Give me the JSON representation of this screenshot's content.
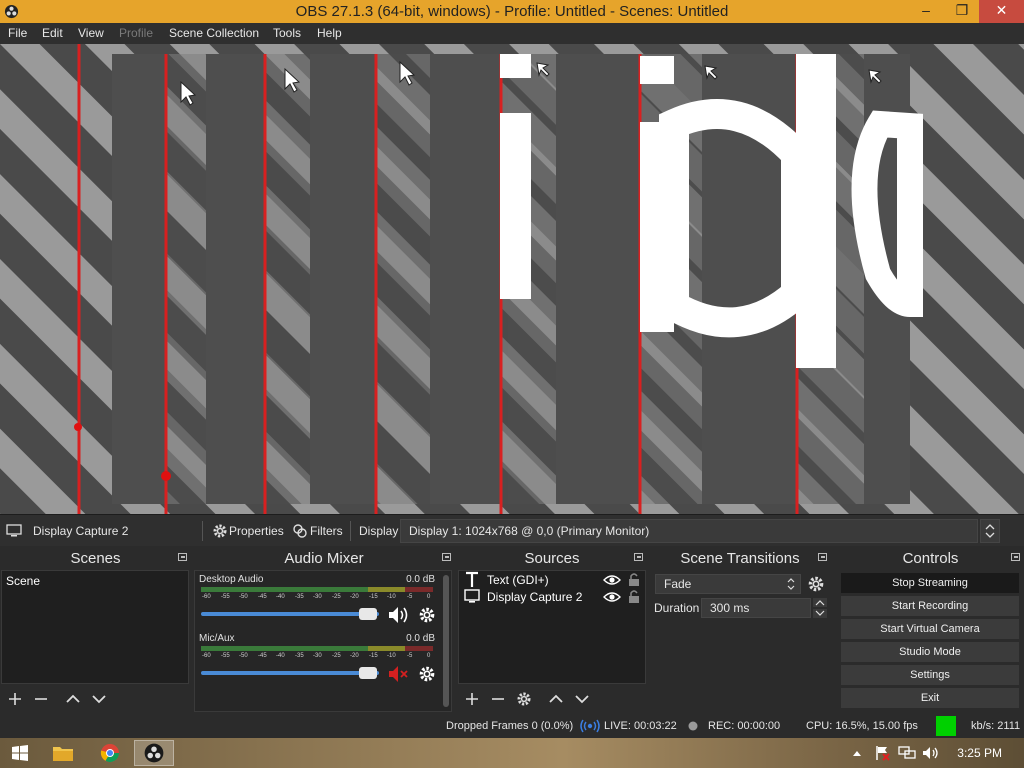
{
  "window": {
    "title": "OBS 27.1.3 (64-bit, windows) - Profile: Untitled - Scenes: Untitled",
    "minimize": "–",
    "restore": "❐",
    "close": "✕"
  },
  "menu": {
    "file": "File",
    "edit": "Edit",
    "view": "View",
    "profile": "Profile",
    "scene_collection": "Scene Collection",
    "tools": "Tools",
    "help": "Help"
  },
  "preview": {
    "text": "id"
  },
  "source_toolbar": {
    "selected_source": "Display Capture 2",
    "properties": "Properties",
    "filters": "Filters",
    "display_label": "Display",
    "display_value": "Display 1: 1024x768 @ 0,0 (Primary Monitor)"
  },
  "scenes": {
    "title": "Scenes",
    "items": [
      "Scene"
    ]
  },
  "mixer": {
    "title": "Audio Mixer",
    "ticks": [
      "-60",
      "-55",
      "-50",
      "-45",
      "-40",
      "-35",
      "-30",
      "-25",
      "-20",
      "-15",
      "-10",
      "-5",
      "0"
    ],
    "channels": [
      {
        "name": "Desktop Audio",
        "db": "0.0 dB",
        "volume": 1.0,
        "muted": false
      },
      {
        "name": "Mic/Aux",
        "db": "0.0 dB",
        "volume": 1.0,
        "muted": true
      }
    ]
  },
  "sources": {
    "title": "Sources",
    "items": [
      {
        "name": "Text (GDI+)",
        "icon": "text-icon"
      },
      {
        "name": "Display Capture 2",
        "icon": "monitor-icon"
      }
    ]
  },
  "transitions": {
    "title": "Scene Transitions",
    "selected": "Fade",
    "duration_label": "Duration",
    "duration_value": "300 ms"
  },
  "controls": {
    "title": "Controls",
    "stop_streaming": "Stop Streaming",
    "start_recording": "Start Recording",
    "start_virtual_camera": "Start Virtual Camera",
    "studio_mode": "Studio Mode",
    "settings": "Settings",
    "exit": "Exit"
  },
  "status": {
    "dropped": "Dropped Frames 0 (0.0%)",
    "live": "LIVE: 00:03:22",
    "rec": "REC: 00:00:00",
    "cpu": "CPU: 16.5%, 15.00 fps",
    "kbs": "kb/s: 2111"
  },
  "taskbar": {
    "clock": "3:25 PM"
  },
  "colors": {
    "title_bar": "#e6a42b",
    "close_button": "#c74b3f",
    "slider": "#4a8bd6",
    "stream_health": "#00d000",
    "muted": "#d42020"
  }
}
